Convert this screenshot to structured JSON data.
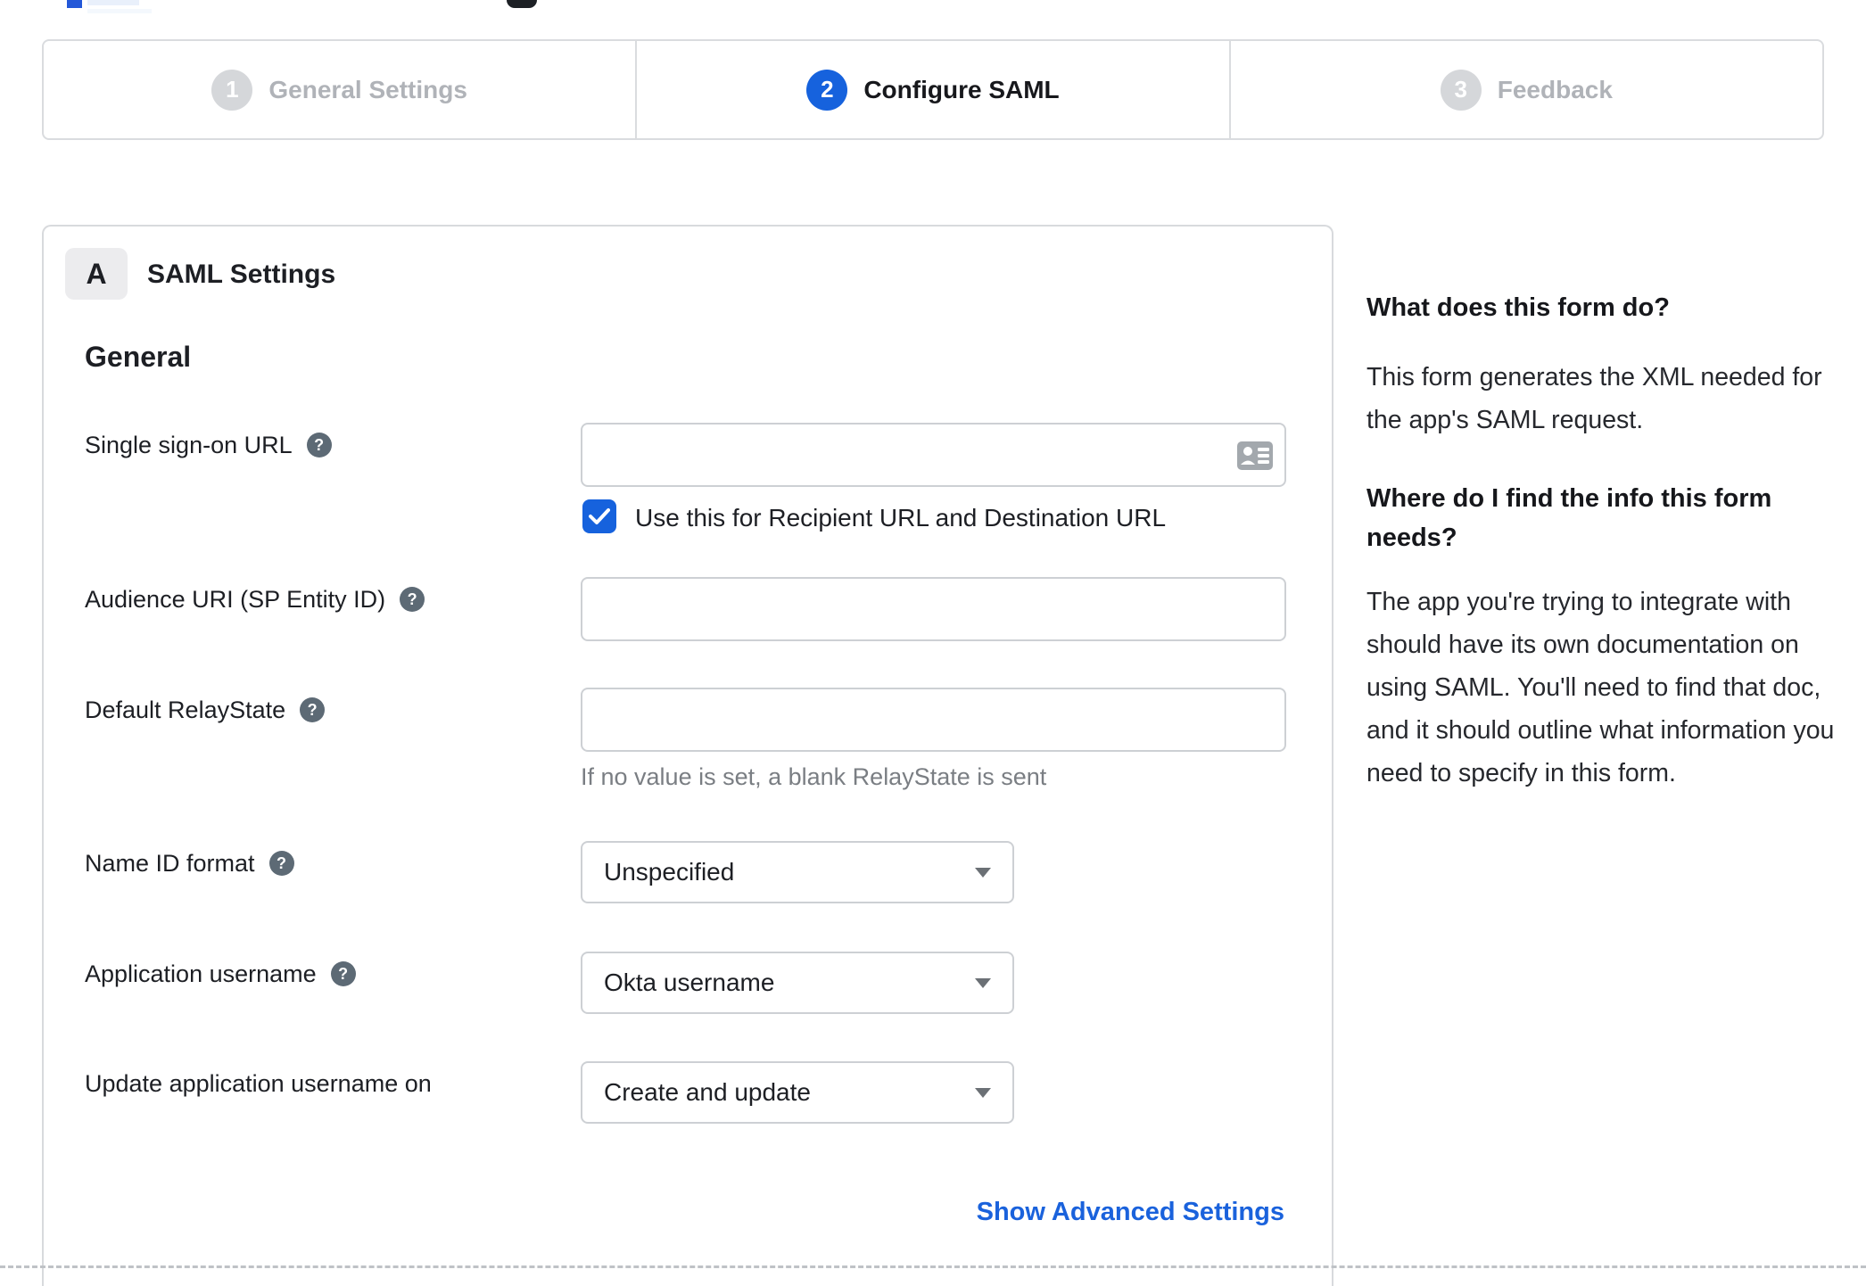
{
  "colors": {
    "accent_blue": "#1662dd",
    "link_blue": "#1a62dc",
    "inactive_gray": "#d5d7da",
    "border_gray": "#d8dadd",
    "help_icon_gray": "#5d6a75"
  },
  "stepper": {
    "steps": [
      {
        "number": "1",
        "label": "General Settings",
        "state": "inactive"
      },
      {
        "number": "2",
        "label": "Configure SAML",
        "state": "active"
      },
      {
        "number": "3",
        "label": "Feedback",
        "state": "inactive"
      }
    ]
  },
  "panel": {
    "badge": "A",
    "title": "SAML Settings",
    "section_heading": "General",
    "fields": [
      {
        "label": "Single sign-on URL",
        "value": "",
        "checkbox_label": "Use this for Recipient URL and Destination URL",
        "checkbox_checked": true
      },
      {
        "label": "Audience URI (SP Entity ID)",
        "value": ""
      },
      {
        "label": "Default RelayState",
        "value": "",
        "helper": "If no value is set, a blank RelayState is sent"
      },
      {
        "label": "Name ID format",
        "value": "Unspecified"
      },
      {
        "label": "Application username",
        "value": "Okta username"
      },
      {
        "label": "Update application username on",
        "value": "Create and update"
      }
    ],
    "advanced_link": "Show Advanced Settings"
  },
  "sidebar": {
    "heading1": "What does this form do?",
    "para1": "This form generates the XML needed for the app's SAML request.",
    "heading2": "Where do I find the info this form needs?",
    "para2": "The app you're trying to integrate with should have its own documentation on using SAML. You'll need to find that doc, and it should outline what information you need to specify in this form."
  },
  "icons": {
    "help": "?"
  }
}
